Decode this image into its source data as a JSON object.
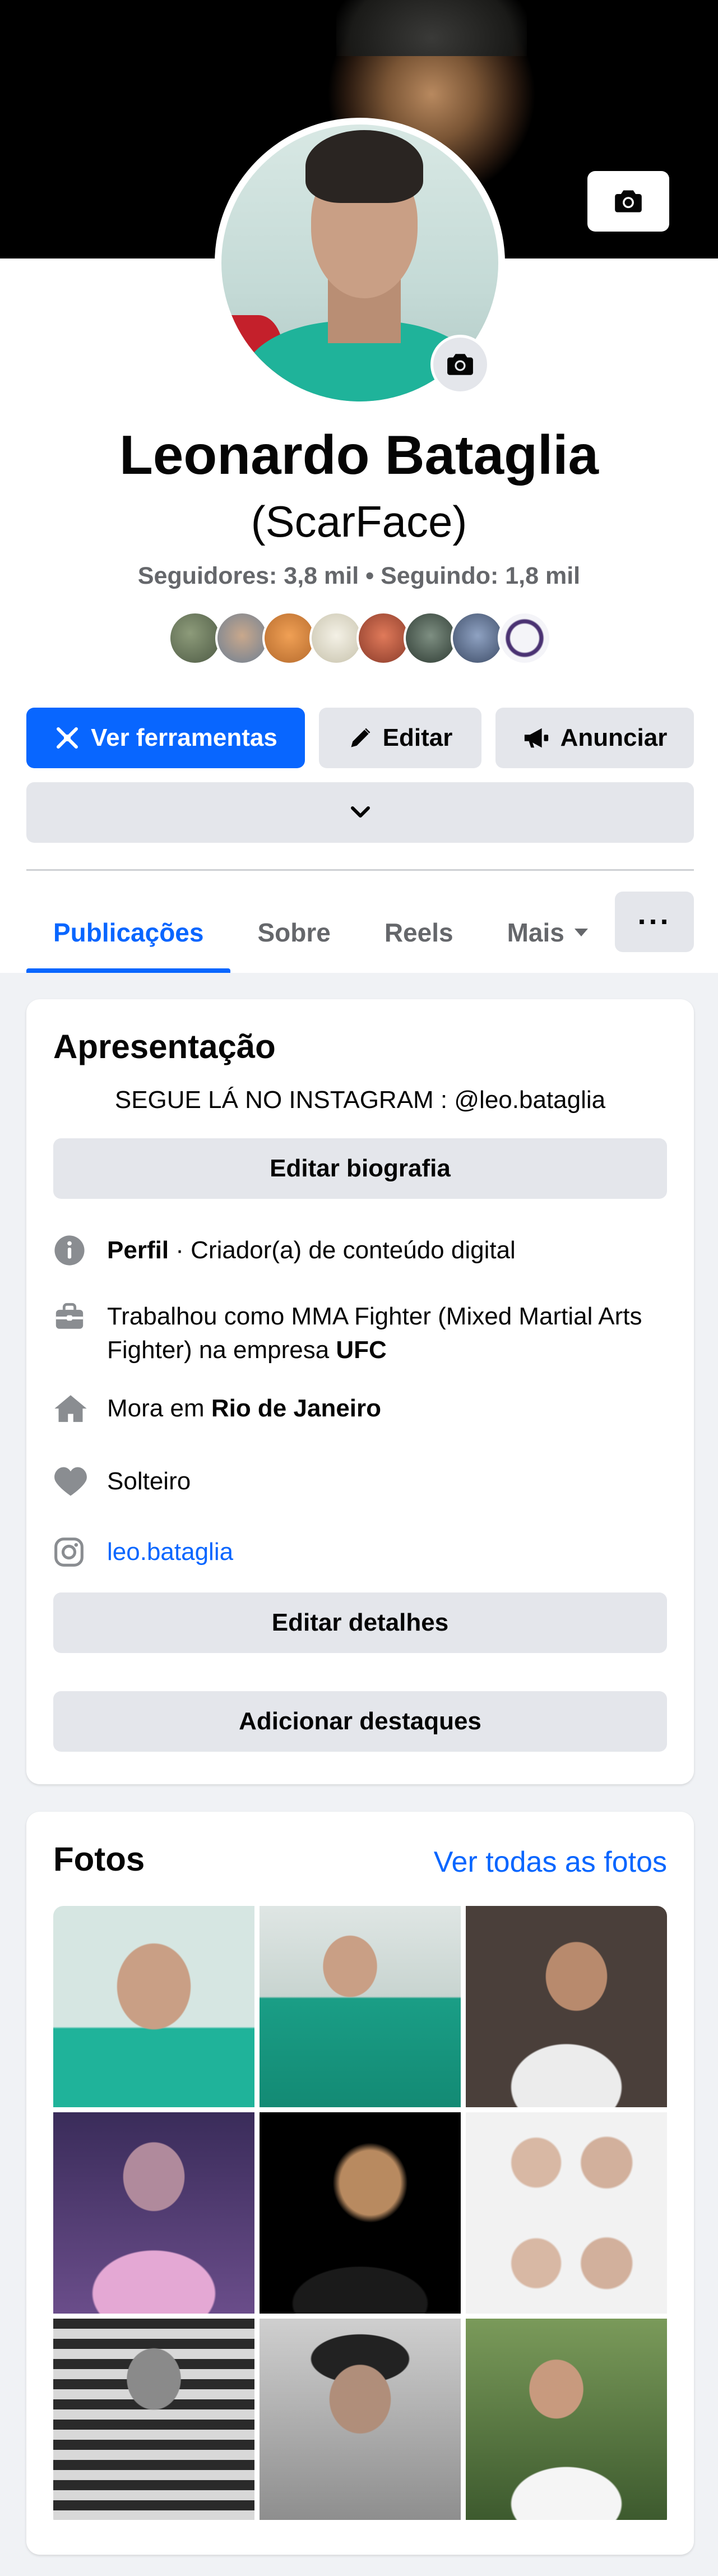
{
  "profile": {
    "name": "Leonardo Bataglia",
    "alt_name": "(ScarFace)",
    "stats": "Seguidores: 3,8 mil • Seguindo: 1,8 mil"
  },
  "actions": {
    "tools": "Ver ferramentas",
    "edit": "Editar",
    "advertise": "Anunciar"
  },
  "tabs": [
    {
      "label": "Publicações"
    },
    {
      "label": "Sobre"
    },
    {
      "label": "Reels"
    },
    {
      "label": "Mais"
    }
  ],
  "more_dots": "···",
  "intro": {
    "title": "Apresentação",
    "bio": "SEGUE LÁ NO INSTAGRAM : @leo.bataglia",
    "edit_bio": "Editar biografia",
    "profile_label": "Perfil",
    "profile_value": " · Criador(a) de conteúdo digital",
    "work_prefix": "Trabalhou como MMA Fighter (Mixed Martial Arts Fighter) na empresa ",
    "work_company": "UFC",
    "lives_prefix": "Mora em ",
    "lives_city": "Rio de Janeiro",
    "relationship": "Solteiro",
    "instagram": "leo.bataglia",
    "edit_details": "Editar detalhes",
    "add_highlights": "Adicionar destaques"
  },
  "photos": {
    "title": "Fotos",
    "see_all": "Ver todas as fotos"
  },
  "colors": {
    "primary": "#0866ff",
    "secondary_text": "#65676b",
    "button_grey": "#e4e6eb",
    "background": "#f0f2f5"
  }
}
